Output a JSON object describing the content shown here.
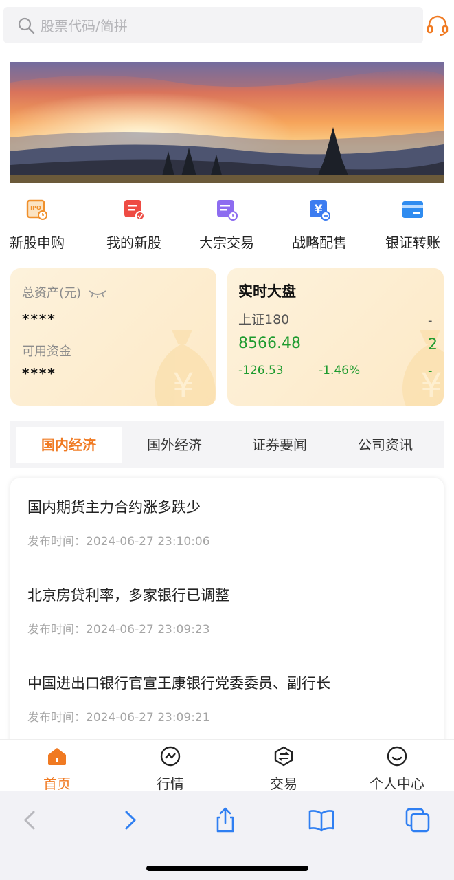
{
  "search": {
    "placeholder": "股票代码/简拼"
  },
  "quick_menu": [
    {
      "label": "新股申购",
      "icon": "ipo-calendar-icon"
    },
    {
      "label": "我的新股",
      "icon": "my-stock-check-icon"
    },
    {
      "label": "大宗交易",
      "icon": "block-trade-clock-icon"
    },
    {
      "label": "战略配售",
      "icon": "yen-placement-icon"
    },
    {
      "label": "银证转账",
      "icon": "bank-card-icon"
    }
  ],
  "assets": {
    "total_label": "总资产(元)",
    "total_value": "****",
    "available_label": "可用资金",
    "available_value": "****"
  },
  "market": {
    "title": "实时大盘",
    "index_name": "上证180",
    "index_value": "8566.48",
    "change": "-126.53",
    "change_pct": "-1.46%",
    "next_partial_top": "-",
    "next_partial_value": "2",
    "next_partial_change": "-"
  },
  "tabs": [
    {
      "label": "国内经济"
    },
    {
      "label": "国外经济"
    },
    {
      "label": "证券要闻"
    },
    {
      "label": "公司资讯"
    }
  ],
  "news": [
    {
      "title": "国内期货主力合约涨多跌少",
      "date": "发布时间：2024-06-27 23:10:06"
    },
    {
      "title": "北京房贷利率，多家银行已调整",
      "date": "发布时间：2024-06-27 23:09:23"
    },
    {
      "title": "中国进出口银行官宣王康银行党委委员、副行长",
      "date": "发布时间：2024-06-27 23:09:21"
    }
  ],
  "bottom_nav": [
    {
      "label": "首页"
    },
    {
      "label": "行情"
    },
    {
      "label": "交易"
    },
    {
      "label": "个人中心"
    }
  ],
  "colors": {
    "accent": "#f07a22",
    "down": "#1e9b2f",
    "card_bg": "#fdeccc"
  }
}
